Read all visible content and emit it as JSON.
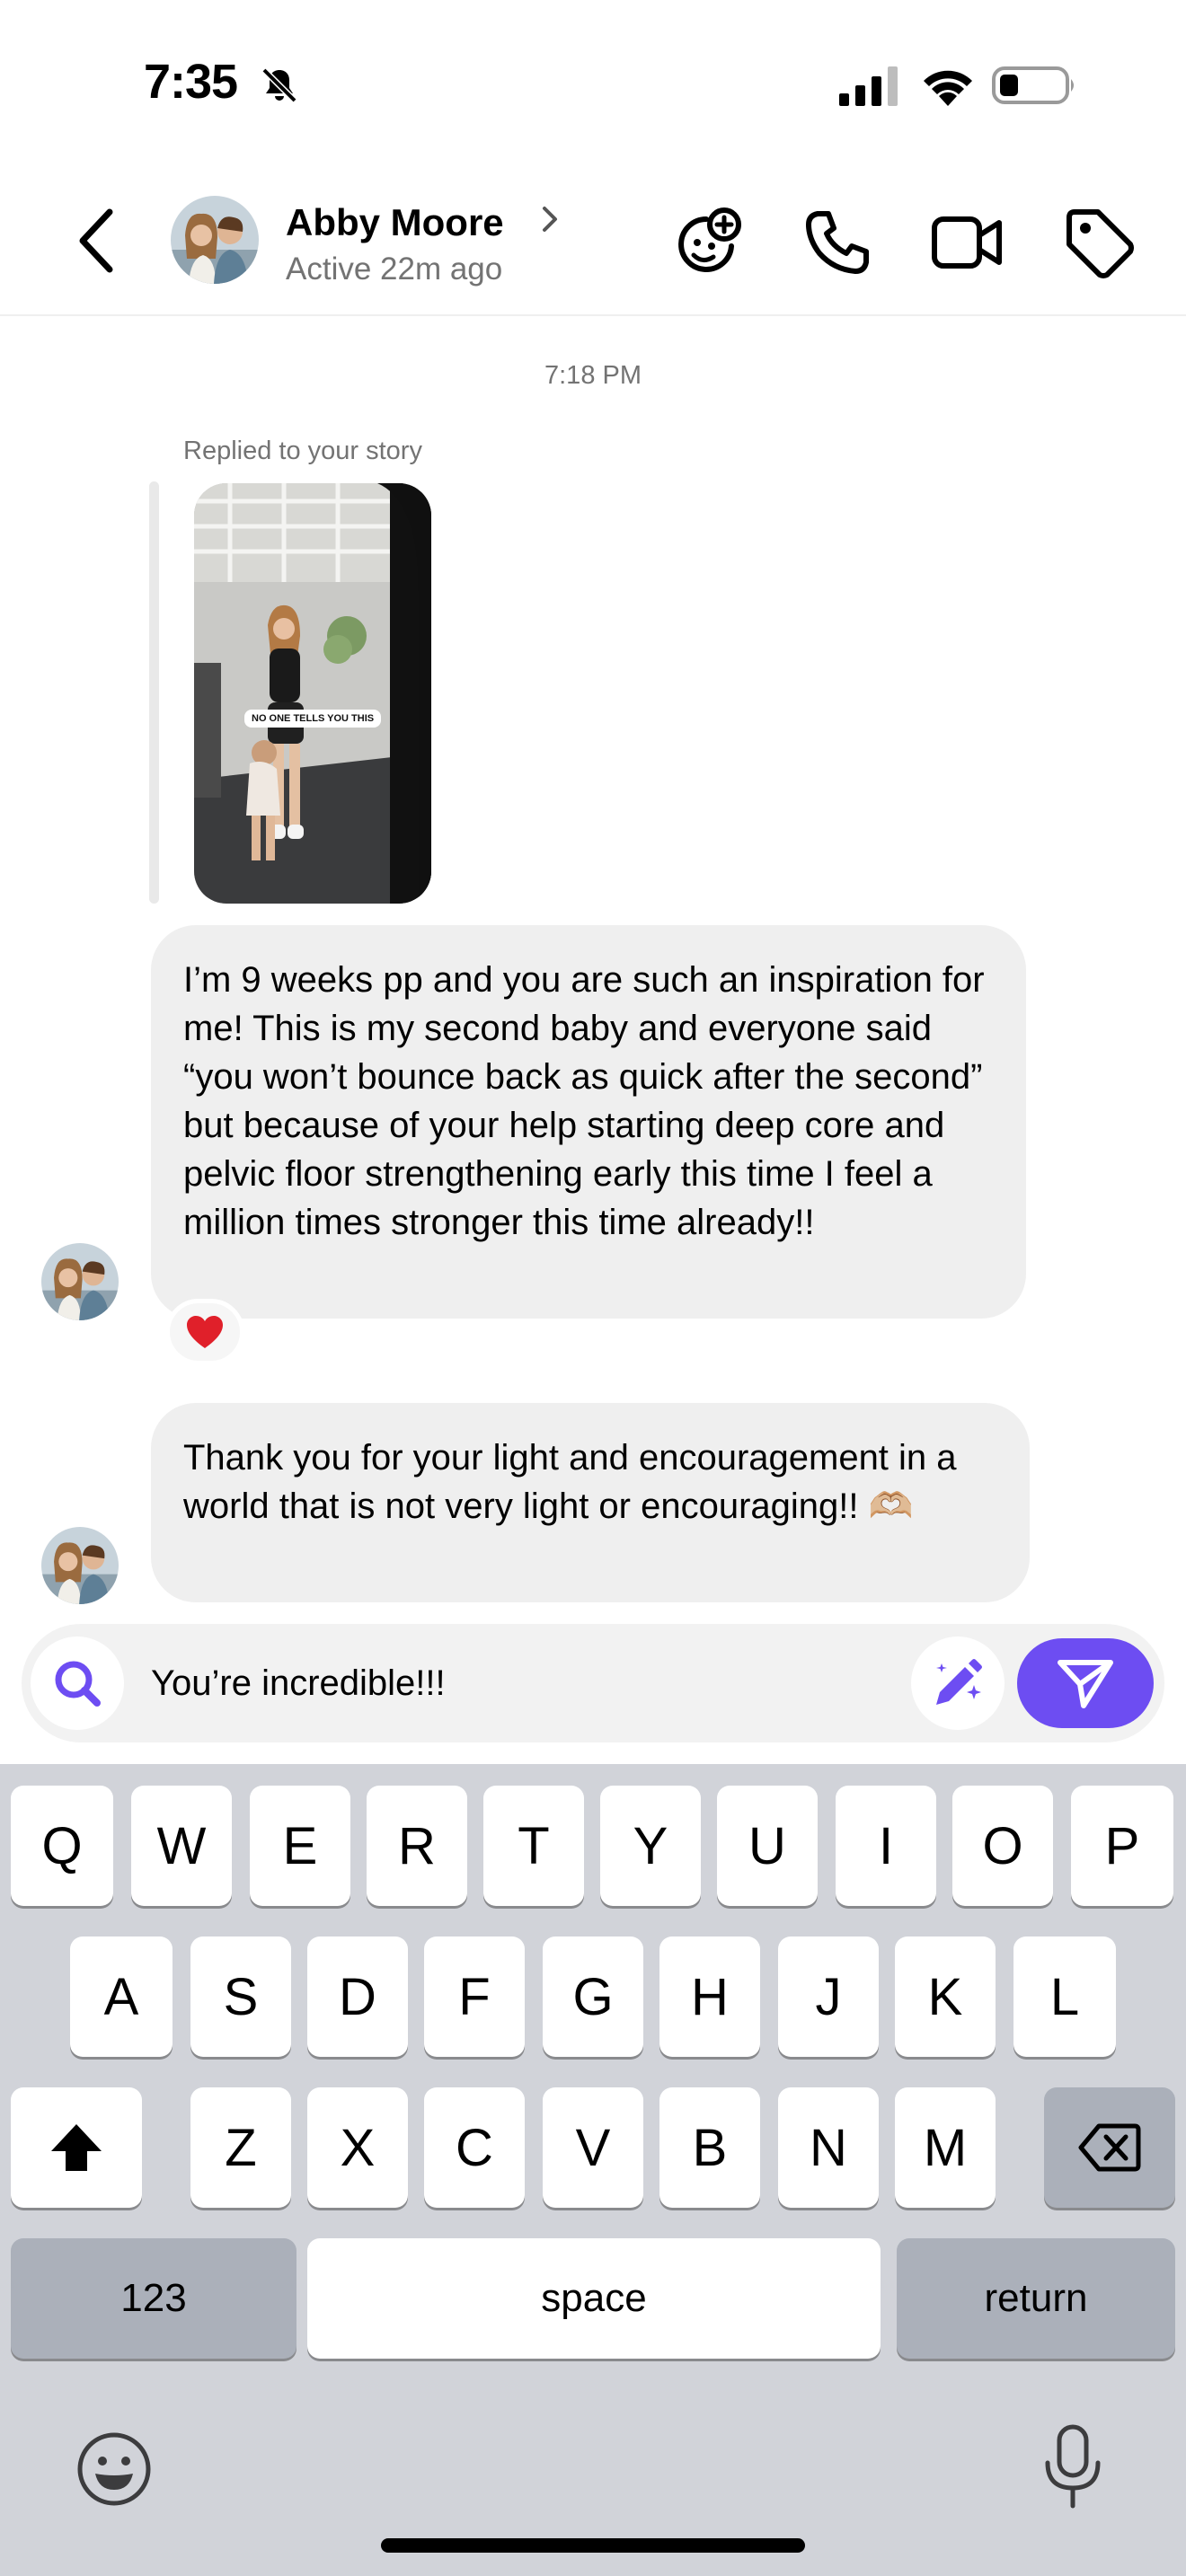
{
  "status_bar": {
    "time": "7:35",
    "icons": [
      "bell-slash-icon",
      "cellular-signal-icon",
      "wifi-icon",
      "battery-icon"
    ]
  },
  "header": {
    "back_icon": "chevron-left-icon",
    "contact_name": "Abby Moore",
    "contact_status": "Active 22m ago",
    "actions": [
      "effects-face-icon",
      "phone-icon",
      "video-icon",
      "tag-icon"
    ]
  },
  "chat": {
    "timestamp": "7:18 PM",
    "story_reply": {
      "label": "Replied to your story",
      "sticker_text": "NO ONE TELLS YOU THIS"
    },
    "messages": [
      {
        "text": "I’m 9 weeks pp and you are such an inspiration for me! This is my second baby and everyone said “you won’t bounce back as quick after the second” but because of your help starting deep core and pelvic floor strengthening early this time I feel a million times stronger this time already!!",
        "reaction": "❤️"
      },
      {
        "text": "Thank you for your light and encouragement in a world that is not very light or encouraging!! 🫶🏼"
      }
    ]
  },
  "composer": {
    "value": "You’re incredible!!!",
    "icons": [
      "search-icon",
      "ai-edit-icon",
      "send-icon"
    ]
  },
  "keyboard": {
    "row1": [
      "Q",
      "W",
      "E",
      "R",
      "T",
      "Y",
      "U",
      "I",
      "O",
      "P"
    ],
    "row2": [
      "A",
      "S",
      "D",
      "F",
      "G",
      "H",
      "J",
      "K",
      "L"
    ],
    "row3": [
      "Z",
      "X",
      "C",
      "V",
      "B",
      "N",
      "M"
    ],
    "numbers_label": "123",
    "space_label": "space",
    "return_label": "return",
    "icons": [
      "shift-icon",
      "delete-icon",
      "emoji-icon",
      "microphone-icon"
    ]
  },
  "colors": {
    "accent": "#6d4df2",
    "bubble": "#efefef",
    "muted_text": "#737373",
    "keyboard_bg": "#d1d3d9"
  }
}
